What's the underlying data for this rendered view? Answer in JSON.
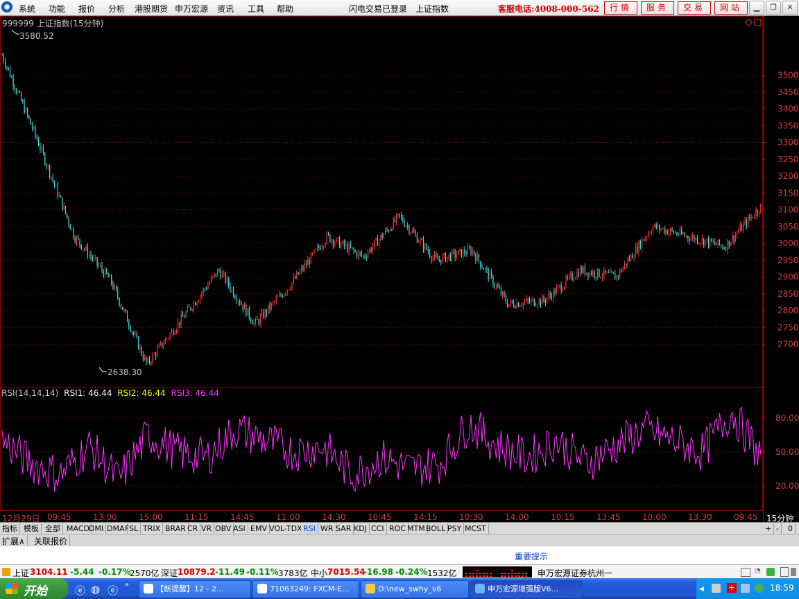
{
  "menu": {
    "items": [
      "系统",
      "功能",
      "报价",
      "分析",
      "港股期货",
      "申万宏源",
      "资讯",
      "工具",
      "帮助"
    ],
    "status_login": "闪电交易已登录",
    "current_index": "上证指数",
    "hotline": "客服电话:4008-000-562",
    "buttons": [
      "行情",
      "服务",
      "交易",
      "网站"
    ],
    "window_buttons": [
      "restore-down-icon",
      "restore-icon",
      "close-icon"
    ]
  },
  "chart": {
    "title": "999999 上证指数(15分钟)",
    "high_label": "3580.52",
    "low_label": "2638.30",
    "price_ticks": [
      "3500",
      "3450",
      "3400",
      "3350",
      "3300",
      "3250",
      "3200",
      "3150",
      "3100",
      "3050",
      "3000",
      "2950",
      "2900",
      "2850",
      "2800",
      "2750",
      "2700"
    ],
    "rsi_ticks": [
      "80.00",
      "50.00",
      "20.00"
    ],
    "time_ticks": [
      "12月29日",
      "09:45",
      "13:00",
      "15:00",
      "11:15",
      "14:45",
      "11:00",
      "14:30",
      "10:45",
      "14:15",
      "10:30",
      "14:00",
      "10:15",
      "13:45",
      "10:00",
      "13:30",
      "09:45"
    ],
    "period_label": "15分钟",
    "colors": {
      "up": "#ff3232",
      "down": "#3cdcdc",
      "rsi": "#ff32ff",
      "grid": "#8b0000",
      "axis_text": "#d23c3c"
    }
  },
  "rsi": {
    "name": "RSI(14,14,14)",
    "rsi1_label": "RSI1:",
    "rsi1_value": "46.44",
    "rsi2_label": "RSI2:",
    "rsi2_value": "46.44",
    "rsi3_label": "RSI3:",
    "rsi3_value": "46.44"
  },
  "chart_data": {
    "type": "line",
    "title": "999999 上证指数(15分钟)",
    "x": [
      "12月29日",
      "09:45",
      "13:00",
      "15:00",
      "11:15",
      "14:45",
      "11:00",
      "14:30",
      "10:45",
      "14:15",
      "10:30",
      "14:00",
      "10:15",
      "13:45",
      "10:00",
      "13:30",
      "09:45"
    ],
    "series": [
      {
        "name": "",
        "values": [
          3560,
          3300,
          3020,
          2890,
          2640,
          2780,
          2920,
          2760,
          2880,
          3020,
          2960,
          3080,
          2950,
          2980,
          2820,
          2830,
          2920,
          2900,
          3050,
          3020,
          2990,
          3110
        ]
      },
      {
        "name": "RSI1",
        "values": [
          60,
          40,
          30,
          55,
          25,
          65,
          50,
          45,
          70,
          60,
          50,
          55,
          30,
          45,
          35,
          40,
          75,
          55,
          45,
          60,
          40,
          55,
          70,
          60,
          50,
          85,
          46
        ]
      }
    ],
    "ylim": [
      2600,
      3600
    ],
    "rsi_ylim": [
      0,
      100
    ]
  },
  "tabs": [
    "指标",
    "模板",
    "全部",
    "MACD",
    "DMI",
    "DMA",
    "FSL",
    "TRIX",
    "BRAR",
    "CR",
    "VR",
    "OBV",
    "ASI",
    "EMV",
    "VOL-TDX",
    "RSI",
    "WR",
    "SAR",
    "KDJ",
    "CCI",
    "ROC",
    "MTM",
    "BOLL",
    "PSY",
    "MCST"
  ],
  "active_tab": "RSI",
  "tab_controls": [
    "+",
    "-",
    "0"
  ],
  "subtabs": [
    "扩展∧",
    "关联报价"
  ],
  "notice": "重要提示",
  "status": {
    "sh_label": "上证",
    "sh_value": "3104.11",
    "sh_change": "-5.44",
    "sh_pct": "-0.17%",
    "sh_amount": "2570亿",
    "sz_label": "深证",
    "sz_value": "10879.2",
    "sz_change": "-11.49",
    "sz_pct": "-0.11%",
    "sz_amount": "3783亿",
    "zx_label": "中小",
    "zx_value": "7015.54",
    "zx_change": "-16.98",
    "zx_pct": "-0.24%",
    "zx_amount": "1532亿",
    "broker": "申万宏源证券杭州一"
  },
  "taskbar": {
    "start": "开始",
    "tasks": [
      "【新提醒】12 - 2...",
      "71063249: FXCM-E...",
      "D:\\new_swhy_v6",
      "申万宏源增强版V6..."
    ],
    "clock": "18:59"
  }
}
